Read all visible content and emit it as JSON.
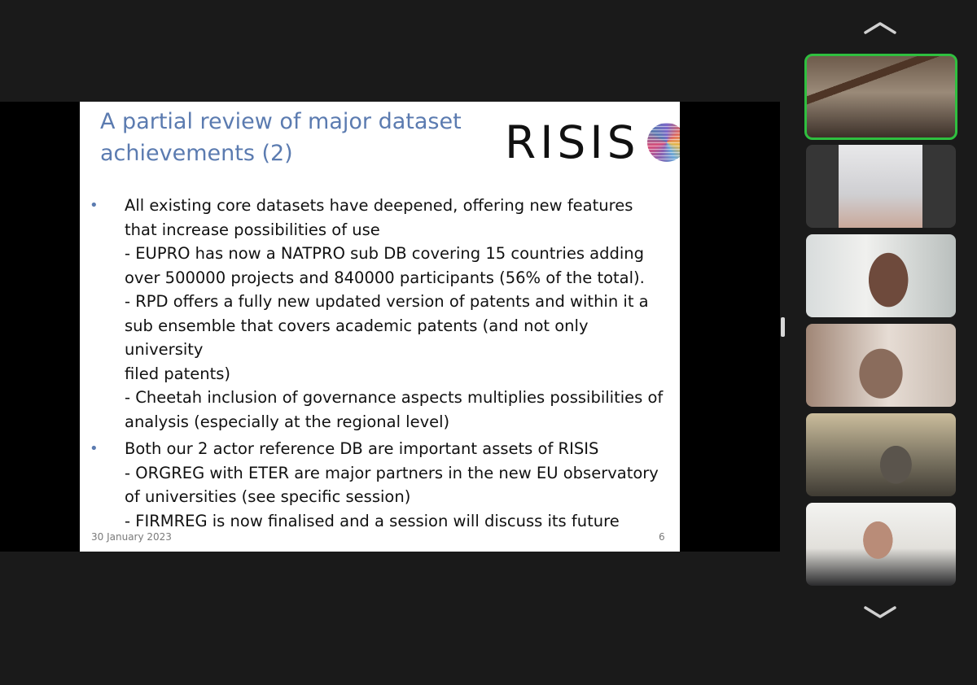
{
  "slide": {
    "title": "A partial review of major dataset achievements (2)",
    "logo_text": "RISIS",
    "bullets": [
      {
        "marker": "•",
        "lines": [
          "All existing core datasets have deepened, offering new features",
          "that increase possibilities of use",
          "- EUPRO has now a NATPRO sub DB covering 15 countries adding",
          "over 500000 projects and 840000 participants (56% of the total).",
          "- RPD offers a fully new updated version of patents and within it a",
          "sub ensemble that covers academic patents (and not only university",
          "filed patents)",
          "- Cheetah inclusion of governance aspects multiplies possibilities of",
          "analysis (especially at the regional level)"
        ]
      },
      {
        "marker": "•",
        "lines": [
          "Both our 2 actor reference DB are important assets of RISIS",
          "- ORGREG with ETER are major partners in the new EU observatory",
          "of universities (see specific session)",
          "- FIRMREG is now finalised and a session will discuss its future"
        ]
      }
    ],
    "footer_date": "30 January 2023",
    "page_number": "6"
  },
  "participants_nav": {
    "up_icon": "chevron-up-icon",
    "down_icon": "chevron-down-icon"
  },
  "colors": {
    "title": "#5b7bb0",
    "active_speaker_border": "#2fbf3f",
    "background": "#1a1a1a"
  }
}
